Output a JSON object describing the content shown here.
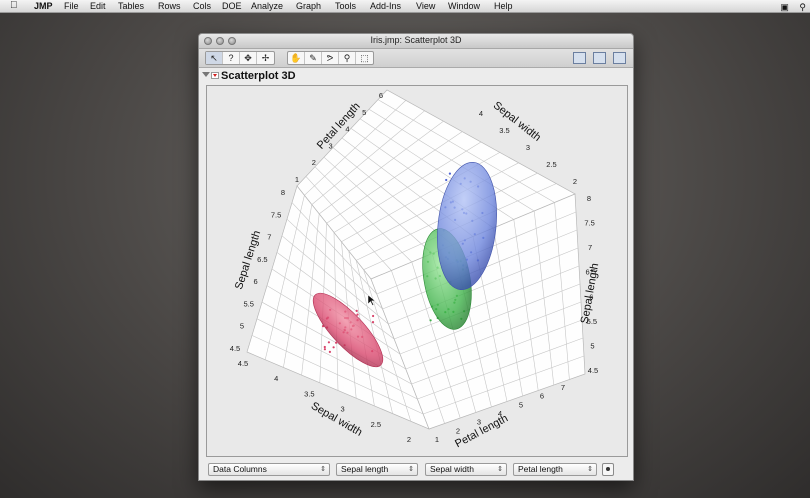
{
  "menubar": {
    "items": [
      "JMP",
      "File",
      "Edit",
      "Tables",
      "Rows",
      "Cols",
      "DOE",
      "Analyze",
      "Graph",
      "Tools",
      "Add-Ins",
      "View",
      "Window",
      "Help"
    ]
  },
  "window": {
    "title": "Iris.jmp: Scatterplot 3D",
    "report_title": "Scatterplot 3D"
  },
  "toolbar": {
    "tools": [
      {
        "name": "arrow-tool-icon",
        "glyph": "↖"
      },
      {
        "name": "help-tool-icon",
        "glyph": "?"
      },
      {
        "name": "crosshair-tool-icon",
        "glyph": "✥"
      },
      {
        "name": "move-tool-icon",
        "glyph": "✢"
      },
      {
        "name": "grabber-tool-icon",
        "glyph": "✋"
      },
      {
        "name": "brush-tool-icon",
        "glyph": "✎"
      },
      {
        "name": "lasso-tool-icon",
        "glyph": "ᕗ"
      },
      {
        "name": "magnifier-tool-icon",
        "glyph": "⚲"
      },
      {
        "name": "selection-tool-icon",
        "glyph": "⬚"
      }
    ]
  },
  "controls": {
    "data_columns": "Data Columns",
    "x_axis": "Sepal length",
    "y_axis": "Sepal width",
    "z_axis": "Petal length"
  },
  "chart_data": {
    "type": "scatter",
    "axes": {
      "top_left": {
        "label": "Petal length",
        "ticks": [
          "6",
          "5",
          "4",
          "3",
          "2",
          "1"
        ]
      },
      "top_right": {
        "label": "Sepal width",
        "ticks": [
          "4",
          "3.5",
          "3",
          "2.5",
          "2"
        ]
      },
      "left": {
        "label": "Sepal length",
        "ticks": [
          "8",
          "7.5",
          "7",
          "6.5",
          "6",
          "5.5",
          "5",
          "4.5"
        ]
      },
      "right": {
        "label": "Sepal length",
        "ticks": [
          "8",
          "7.5",
          "7",
          "6.5",
          "6",
          "5.5",
          "5",
          "4.5"
        ]
      },
      "bottom_left": {
        "label": "Sepal width",
        "ticks": [
          "4.5",
          "4",
          "3.5",
          "3",
          "2.5",
          "2"
        ]
      },
      "bottom_right": {
        "label": "Petal length",
        "ticks": [
          "1",
          "2",
          "3",
          "4",
          "5",
          "6",
          "7"
        ]
      }
    },
    "series": [
      {
        "color": "#d8436a"
      },
      {
        "color": "#3fb24a"
      },
      {
        "color": "#4c63d4"
      }
    ]
  }
}
